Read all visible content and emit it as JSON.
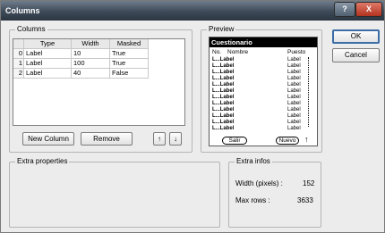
{
  "window": {
    "title": "Columns",
    "help_label": "?",
    "close_label": "X"
  },
  "columns_group": {
    "label": "Columns",
    "headers": [
      "Type",
      "Width",
      "Masked"
    ],
    "rows": [
      {
        "index": "0",
        "type": "Label",
        "width": "10",
        "masked": "True"
      },
      {
        "index": "1",
        "type": "Label",
        "width": "100",
        "masked": "True"
      },
      {
        "index": "2",
        "type": "Label",
        "width": "40",
        "masked": "False"
      }
    ],
    "new_column_label": "New Column",
    "remove_label": "Remove",
    "up_label": "↑",
    "down_label": "↓"
  },
  "preview": {
    "label": "Preview",
    "bar_title": "Cuestionario",
    "head_no": "No.",
    "head_name": "Nombre",
    "head_puesto": "Puesto",
    "rows": [
      {
        "left": "L...Label",
        "right": "Label"
      },
      {
        "left": "L...Label",
        "right": "Label"
      },
      {
        "left": "L...Label",
        "right": "Label"
      },
      {
        "left": "L...Label",
        "right": "Label"
      },
      {
        "left": "L...Label",
        "right": "Label"
      },
      {
        "left": "L...Label",
        "right": "Label"
      },
      {
        "left": "L...Label",
        "right": "Label"
      },
      {
        "left": "L...Label",
        "right": "Label"
      },
      {
        "left": "L...Label",
        "right": "Label"
      },
      {
        "left": "L...Label",
        "right": "Label"
      },
      {
        "left": "L...Label",
        "right": "Label"
      },
      {
        "left": "L...Label",
        "right": "Label"
      }
    ],
    "salir_label": "Salir",
    "nuevo_label": "Nuevo",
    "arrow_label": "↑"
  },
  "buttons": {
    "ok_label": "OK",
    "cancel_label": "Cancel"
  },
  "extra_properties": {
    "label": "Extra properties"
  },
  "extra_infos": {
    "label": "Extra infos",
    "width_label": "Width (pixels) :",
    "width_value": "152",
    "maxrows_label": "Max rows :",
    "maxrows_value": "3633"
  }
}
